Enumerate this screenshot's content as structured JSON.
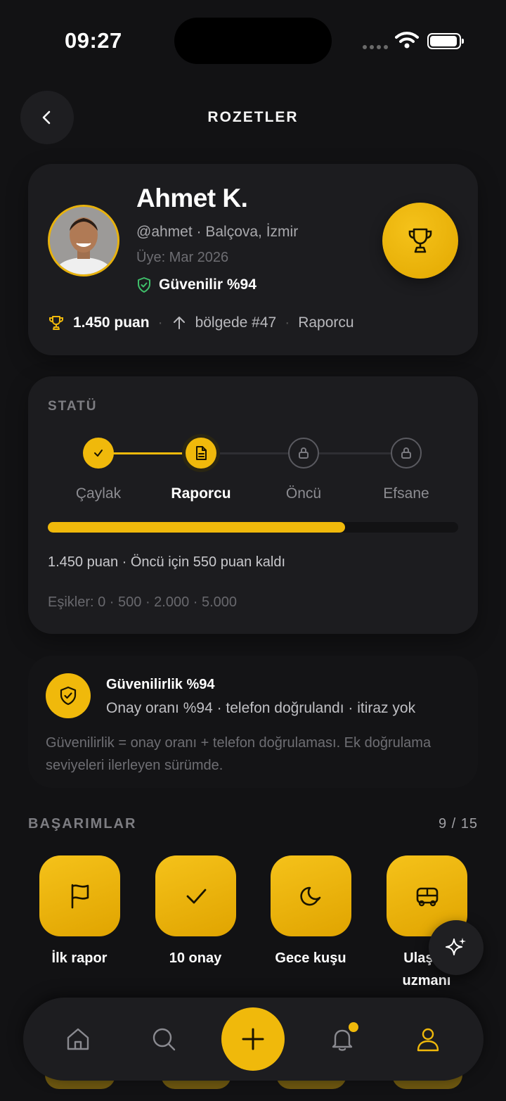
{
  "status_bar": {
    "time": "09:27"
  },
  "header": {
    "title": "ROZETLER"
  },
  "profile": {
    "name": "Ahmet K.",
    "handle_location": "@ahmet · Balçova, İzmir",
    "member_since": "Üye: Mar 2026",
    "trust": "Güvenilir %94",
    "points": "1.450 puan",
    "region_rank": "bölgede #47",
    "level": "Raporcu"
  },
  "status": {
    "section_label": "STATÜ",
    "steps": [
      {
        "label": "Çaylak",
        "state": "done"
      },
      {
        "label": "Raporcu",
        "state": "current"
      },
      {
        "label": "Öncü",
        "state": "locked"
      },
      {
        "label": "Efsane",
        "state": "locked"
      }
    ],
    "progress_fraction": 0.725,
    "progress_text": "1.450 puan · Öncü için 550 puan kaldı",
    "thresholds": "Eşikler: 0 · 500 · 2.000 · 5.000"
  },
  "reliability": {
    "title": "Güvenilirlik %94",
    "subtitle": "Onay oranı %94 · telefon doğrulandı · itiraz yok",
    "note": "Güvenilirlik = onay oranı + telefon doğrulaması. Ek doğrulama seviyeleri ilerleyen sürümde."
  },
  "achievements": {
    "section_label": "BAŞARIMLAR",
    "count": "9 / 15",
    "items": [
      {
        "label": "İlk rapor",
        "icon": "flag-icon"
      },
      {
        "label": "10 onay",
        "icon": "check-icon"
      },
      {
        "label": "Gece kuşu",
        "icon": "moon-icon"
      },
      {
        "label": "Ulaşım uzmanı",
        "icon": "bus-icon"
      }
    ]
  },
  "nav": {
    "items": [
      "home-icon",
      "search-icon",
      "plus-icon",
      "bell-icon",
      "user-icon"
    ]
  },
  "colors": {
    "accent": "#f0b90b",
    "background": "#121214",
    "card": "#1c1c1f",
    "verified_green": "#3fbf6a"
  }
}
